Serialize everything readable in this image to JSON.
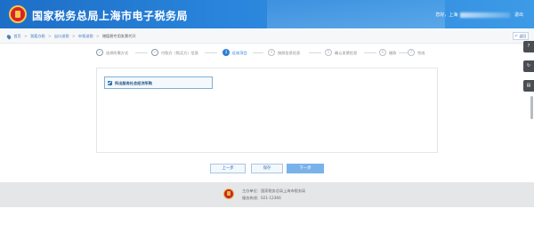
{
  "header": {
    "title": "国家税务总局上海市电子税务局",
    "greeting": "您好，上海",
    "user_masked": "",
    "exit_label": "退出"
  },
  "breadcrumb": {
    "items": [
      "首页",
      "我要办税",
      "出口退税",
      "申报退税",
      "增值税专用发票代开"
    ],
    "current": "增值税专用发票代开",
    "back_label": "返回"
  },
  "steps": [
    {
      "num": "1",
      "label": "选择所需方式",
      "state": "done"
    },
    {
      "num": "2",
      "label": "付款方（购买方）信息",
      "state": "done"
    },
    {
      "num": "3",
      "label": "征收项目",
      "state": "active"
    },
    {
      "num": "4",
      "label": "按照信息信息",
      "state": "todo"
    },
    {
      "num": "5",
      "label": "确认发票信息",
      "state": "todo"
    },
    {
      "num": "6",
      "label": "缴款",
      "state": "todo"
    },
    {
      "num": "7",
      "label": "完成",
      "state": "todo"
    }
  ],
  "main": {
    "option_label": "所出服务社会经济所购",
    "option_checked": true
  },
  "buttons": {
    "prev": "上一步",
    "save": "保存",
    "next": "下一步"
  },
  "footer": {
    "host_line": "主办单位：国家税务总局上海市税务局",
    "hotline_line": "服务热线：021-12366"
  },
  "side_tools": [
    "help-icon",
    "refresh-icon",
    "clipboard-icon"
  ],
  "colors": {
    "header_blue": "#2a86dc",
    "active_step": "#2f7fd3",
    "primary_button": "#79b2ea",
    "footer_bg": "#e5e6e8"
  }
}
